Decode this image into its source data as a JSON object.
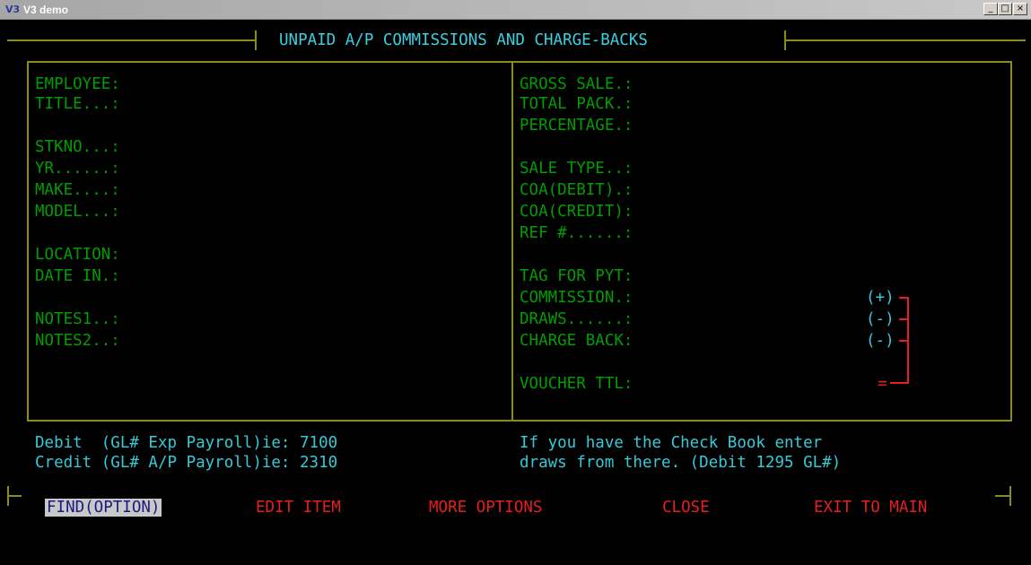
{
  "window": {
    "icon": "V3",
    "title": "V3 demo",
    "controls": {
      "minimize": "_",
      "maximize": "□",
      "close": "×"
    }
  },
  "header": {
    "title": "UNPAID A/P COMMISSIONS AND CHARGE-BACKS"
  },
  "left_fields": [
    "EMPLOYEE:",
    "TITLE...:",
    "STKNO...:",
    "YR......:",
    "MAKE....:",
    "MODEL...:",
    "LOCATION:",
    "DATE IN.:",
    "NOTES1..:",
    "NOTES2..:"
  ],
  "right_fields": [
    "GROSS SALE.:",
    "TOTAL PACK.:",
    "PERCENTAGE.:",
    "SALE TYPE..:",
    "COA(DEBIT).:",
    "COA(CREDIT):",
    "REF #......:",
    "TAG FOR PYT:",
    "COMMISSION.:",
    "DRAWS......:",
    "CHARGE BACK:",
    "VOUCHER TTL:"
  ],
  "operators": {
    "commission": "(+)",
    "draws": "(-)",
    "charge_back": "(-)",
    "total": "="
  },
  "info": {
    "debit": "Debit  (GL# Exp Payroll)ie: 7100",
    "credit": "Credit (GL# A/P Payroll)ie: 2310",
    "note1": "If you have the Check Book enter",
    "note2": "draws from there. (Debit 1295 GL#)"
  },
  "menu": [
    "FIND(OPTION)",
    "EDIT ITEM",
    "MORE OPTIONS",
    "CLOSE",
    "EXIT TO MAIN"
  ],
  "colors": {
    "label": "#009e00",
    "info": "#36c9d6",
    "menu": "#e61e1e",
    "frame": "#8b8b1e"
  }
}
